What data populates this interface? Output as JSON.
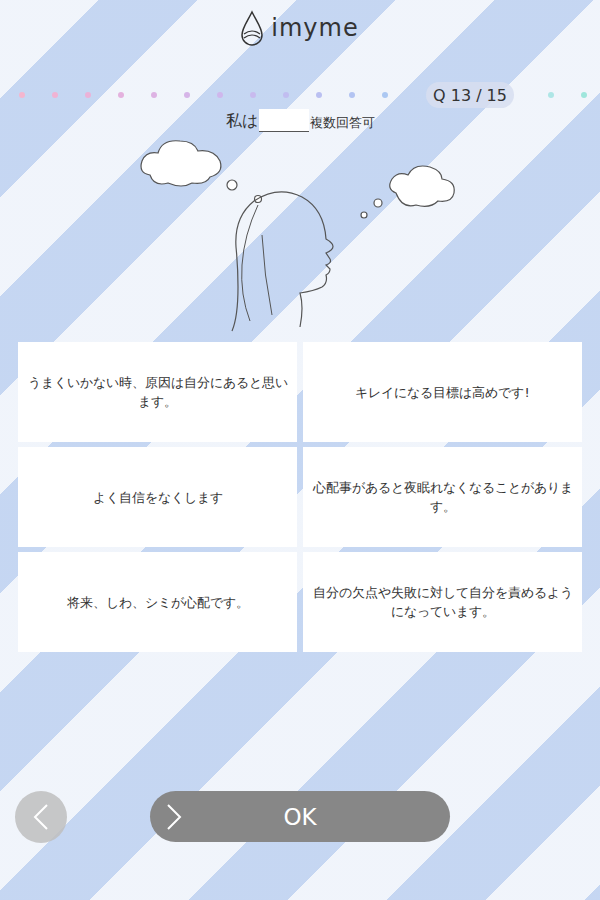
{
  "logo": {
    "text": "imyme"
  },
  "progress": {
    "counter": "Q 13 / 15",
    "dots_before": [
      {
        "color": "#f4b6cf"
      },
      {
        "color": "#f0b3d3"
      },
      {
        "color": "#ebb2d8"
      },
      {
        "color": "#e4b2de"
      },
      {
        "color": "#ddb3e3"
      },
      {
        "color": "#d6b5e8"
      },
      {
        "color": "#cfb7ec"
      },
      {
        "color": "#c8baee"
      },
      {
        "color": "#c1bdf0"
      },
      {
        "color": "#bac0f1"
      },
      {
        "color": "#b3c4f2"
      },
      {
        "color": "#acc8f2"
      }
    ],
    "dots_after": [
      {
        "color": "#aee6e6"
      },
      {
        "color": "#9fe6dc"
      }
    ]
  },
  "question": {
    "prefix": "私は",
    "note": "複数回答可"
  },
  "options": [
    {
      "label": "うまくいかない時、原因は自分にあると思います。",
      "selected": false
    },
    {
      "label": "キレイになる目標は高めです!",
      "selected": false
    },
    {
      "label": "よく自信をなくします",
      "selected": false
    },
    {
      "label": "心配事があると夜眠れなくなることがあります。",
      "selected": false
    },
    {
      "label": "将来、しわ、シミが心配です。",
      "selected": false
    },
    {
      "label": "自分の欠点や失敗に対して自分を責めるようになっています。",
      "selected": false
    }
  ],
  "buttons": {
    "ok": "OK"
  }
}
